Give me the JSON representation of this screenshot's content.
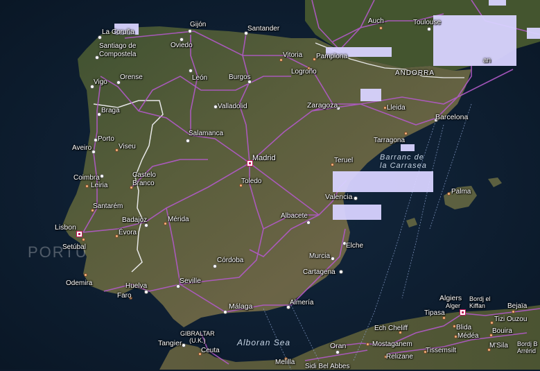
{
  "map": {
    "country_labels": {
      "portugal_partial": "PORTU"
    },
    "region_labels": {
      "andorra": "ANDORRA",
      "gibraltar": "GIBRALTAR\n(U.K.)"
    },
    "sea_labels": {
      "alboran": "Alboran Sea",
      "barranc": "Barranc de\nla Carrasea"
    },
    "cities": {
      "la_coruna": "La Coruña",
      "gijon": "Gijón",
      "santander": "Santander",
      "santiago": "Santiago de\nCompostela",
      "oviedo": "Oviedo",
      "vitoria": "Vitoria",
      "pamplona": "Pamplona",
      "auch": "Auch",
      "toulouse": "Toulouse",
      "tarbes_partial": "an",
      "vigo": "Vigo",
      "orense": "Orense",
      "leon": "León",
      "burgos": "Burgos",
      "logrono": "Logroño",
      "braga": "Braga",
      "valladolid": "Valladolid",
      "zaragoza": "Zaragoza",
      "lleida": "Lleida",
      "barcelona": "Barcelona",
      "porto": "Porto",
      "aveiro": "Aveiro",
      "viseu": "Viseu",
      "salamanca": "Salamanca",
      "tarragona": "Tarragona",
      "madrid": "Madrid",
      "coimbra": "Coimbra",
      "castelo_branco": "Castelo\nBranco",
      "teruel": "Teruel",
      "leiria": "Leiria",
      "toledo": "Toledo",
      "palma": "Palma",
      "valencia": "Valencia",
      "santarem": "Santarém",
      "badajoz": "Badajoz",
      "merida": "Mérida",
      "albacete": "Albacete",
      "lisbon": "Lisbon",
      "evora": "Évora",
      "setubal": "Setúbal",
      "elche": "Elche",
      "murcia": "Murcia",
      "cordoba": "Córdoba",
      "cartagena": "Cartagena",
      "odemira": "Odemira",
      "huelva": "Huelva",
      "seville": "Seville",
      "faro": "Faro",
      "malaga": "Málaga",
      "almeria": "Almería",
      "algiers": "Algiers",
      "alger": "Alger",
      "bordj_kiffan": "Bordj el\nKiffan",
      "bejaia": "Bejaïa",
      "tipasa": "Tipasa",
      "blida": "Blida",
      "tizi_ouzou": "Tizi Ouzou",
      "medea": "Médéa",
      "bouira": "Bouira",
      "tangier": "Tangier",
      "ceuta": "Ceuta",
      "oran": "Oran",
      "ech_cheliff": "Ech Cheliff",
      "mostaganem": "Mostaganem",
      "tissemsilt": "Tissemsilt",
      "msila": "M'Sila",
      "bordj_partial": "Bordj B\nArrérid",
      "relizane": "Relizane",
      "melilla": "Melilla",
      "sidi_bel_abbes": "Sidi Bel Abbes"
    },
    "colors": {
      "sea": "#0e1f33",
      "land": "#4d5a33",
      "roads": "#b25ac8",
      "border": "#e8e8e8",
      "censor": "#d8d3ff"
    }
  }
}
